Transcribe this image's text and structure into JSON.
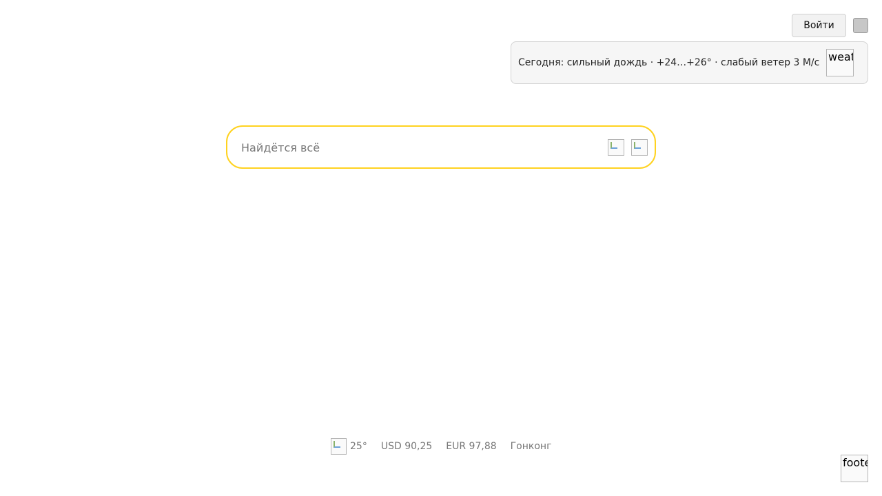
{
  "header": {
    "login_label": "Войти",
    "menu_icon": "menu-icon"
  },
  "weather_banner": {
    "text": "Сегодня: сильный дождь · +24…+26° · слабый ветер 3 М/с",
    "image_alt": "weat"
  },
  "search": {
    "placeholder": "Найдётся всё",
    "value": "",
    "keyboard_icon": "keyboard-icon",
    "voice_icon": "voice-search-icon"
  },
  "footer": {
    "weather_icon": "weather-icon",
    "temperature": "25°",
    "usd": "USD 90,25",
    "eur": "EUR 97,88",
    "city": "Гонконг",
    "corner_image_alt": "foote"
  },
  "colors": {
    "search_border": "#ffd21f",
    "footer_text": "#777777"
  }
}
